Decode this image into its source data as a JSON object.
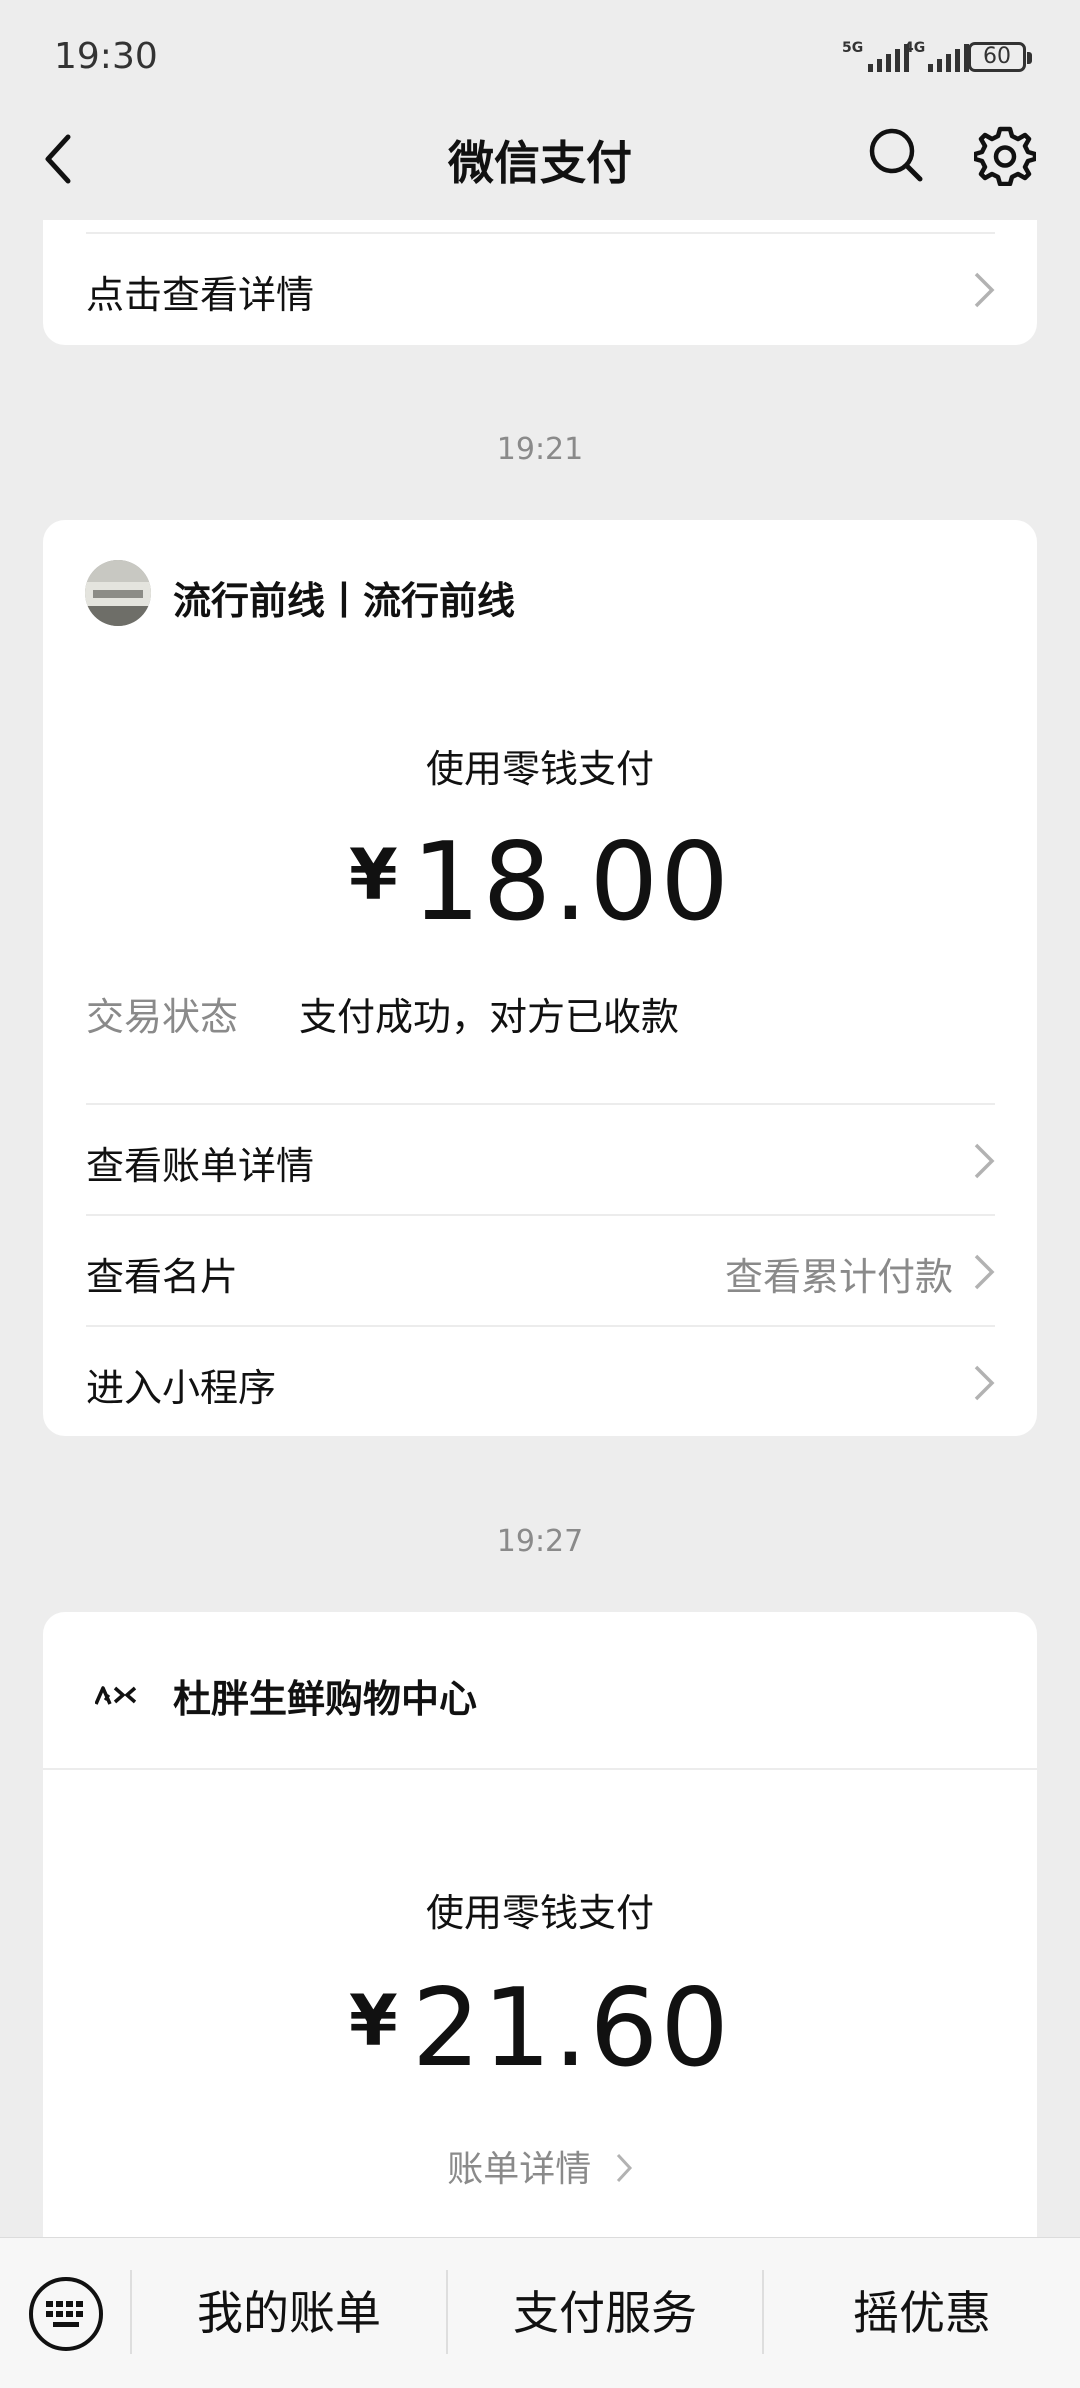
{
  "status_bar": {
    "time": "19:30",
    "network_1": "5G",
    "network_2": "4G",
    "battery": "60"
  },
  "nav": {
    "title": "微信支付"
  },
  "top_card": {
    "detail_label": "点击查看详情"
  },
  "messages": [
    {
      "timestamp": "19:21",
      "merchant": "流行前线丨流行前线",
      "pay_method": "使用零钱支付",
      "currency": "¥",
      "amount": "18.00",
      "status_label": "交易状态",
      "status_value": "支付成功，对方已收款",
      "rows": [
        {
          "label": "查看账单详情",
          "right": ""
        },
        {
          "label": "查看名片",
          "right": "查看累计付款"
        },
        {
          "label": "进入小程序",
          "right": ""
        }
      ]
    },
    {
      "timestamp": "19:27",
      "merchant": "杜胖生鲜购物中心",
      "pay_method": "使用零钱支付",
      "currency": "¥",
      "amount": "21.60",
      "bill_link": "账单详情"
    }
  ],
  "bottom_tabs": [
    "我的账单",
    "支付服务",
    "摇优惠"
  ],
  "colors": {
    "background": "#ededed",
    "card": "#ffffff",
    "secondary_text": "#8a8a8a",
    "chevron": "#b2b2b2"
  }
}
